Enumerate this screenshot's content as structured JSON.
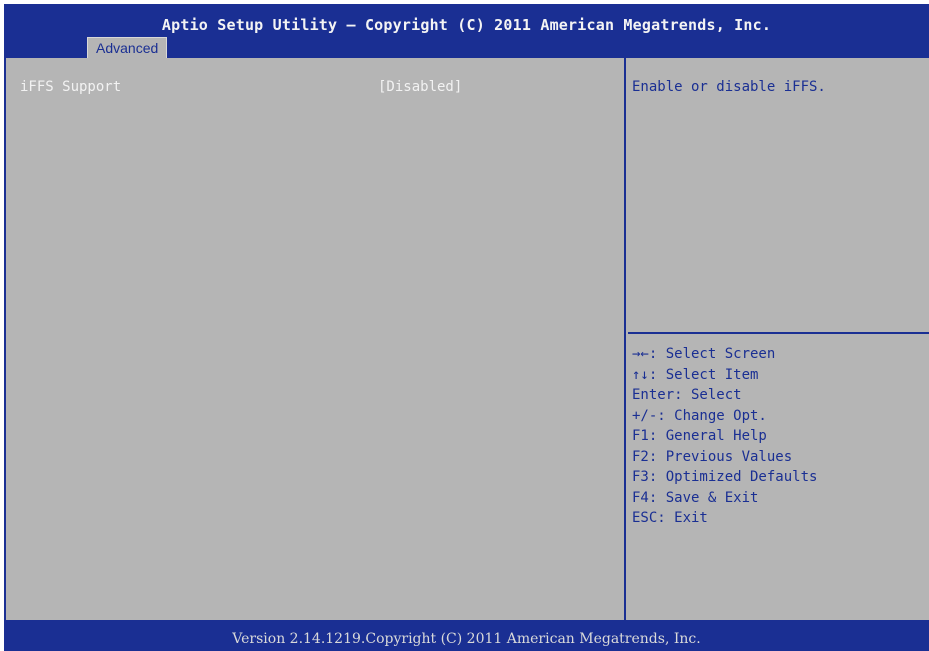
{
  "title": "Aptio Setup Utility – Copyright (C) 2011 American Megatrends, Inc.",
  "tabs": [
    {
      "label": "Advanced",
      "selected": true
    }
  ],
  "setting": {
    "label": "iFFS Support",
    "value": "[Disabled]"
  },
  "help": "Enable or disable iFFS.",
  "keys": [
    "→←: Select Screen",
    "↑↓: Select Item",
    "Enter: Select",
    "+/-: Change Opt.",
    "F1: General Help",
    "F2: Previous Values",
    "F3: Optimized Defaults",
    "F4: Save & Exit",
    "ESC: Exit"
  ],
  "footer": "Version 2.14.1219.Copyright (C) 2011 American Megatrends, Inc.",
  "colors": {
    "bar": "#1a2f93",
    "background": "#b5b5b5",
    "item_text": "#f2f2f2",
    "help_text": "#1a2f93"
  }
}
